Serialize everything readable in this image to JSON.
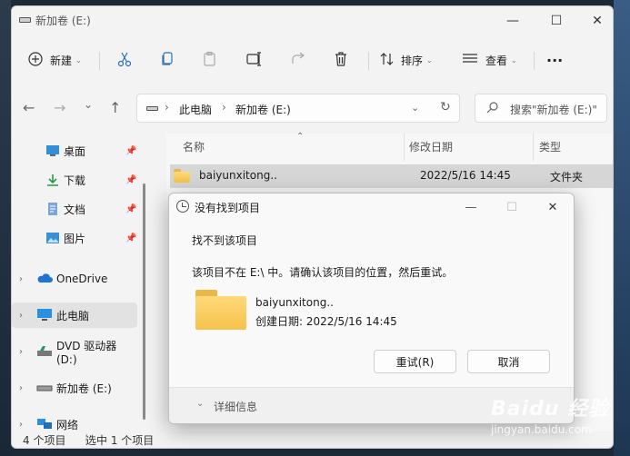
{
  "window": {
    "title": "新加卷 (E:)",
    "minimize": "—",
    "maximize": "☐",
    "close": "✕"
  },
  "toolbar": {
    "new_label": "新建",
    "sort_label": "排序",
    "view_label": "查看",
    "more": "···"
  },
  "address": {
    "back": "←",
    "forward": "→",
    "recent": "⌄",
    "up": "↑",
    "crumbs": [
      "此电脑",
      "新加卷 (E:)"
    ],
    "refresh": "↻",
    "search_placeholder": "搜索\"新加卷 (E:)\""
  },
  "sidebar": {
    "quick": [
      {
        "label": "桌面",
        "icon": "desktop-icon"
      },
      {
        "label": "下载",
        "icon": "download-icon"
      },
      {
        "label": "文档",
        "icon": "document-icon"
      },
      {
        "label": "图片",
        "icon": "picture-icon"
      }
    ],
    "tree": [
      {
        "label": "OneDrive",
        "icon": "cloud-icon"
      },
      {
        "label": "此电脑",
        "icon": "computer-icon"
      },
      {
        "label": "DVD 驱动器 (D:)",
        "icon": "dvd-icon"
      },
      {
        "label": "新加卷 (E:)",
        "icon": "drive-icon"
      },
      {
        "label": "网络",
        "icon": "network-icon"
      }
    ]
  },
  "files": {
    "columns": [
      "名称",
      "修改日期",
      "类型"
    ],
    "rows": [
      {
        "name": "baiyunxitong..",
        "date": "2022/5/16 14:45",
        "type": "文件夹"
      }
    ]
  },
  "status": {
    "count": "4 个项目",
    "selected": "选中 1 个项目"
  },
  "dialog": {
    "title": "没有找到项目",
    "heading": "找不到该项目",
    "message": "该项目不在 E:\\ 中。请确认该项目的位置，然后重试。",
    "file_name": "baiyunxitong..",
    "file_date": "创建日期: 2022/5/16 14:45",
    "retry": "重试(R)",
    "cancel": "取消",
    "details": "详细信息"
  },
  "watermark": {
    "brand": "Baidu 经验",
    "url": "jingyan.baidu.com"
  }
}
